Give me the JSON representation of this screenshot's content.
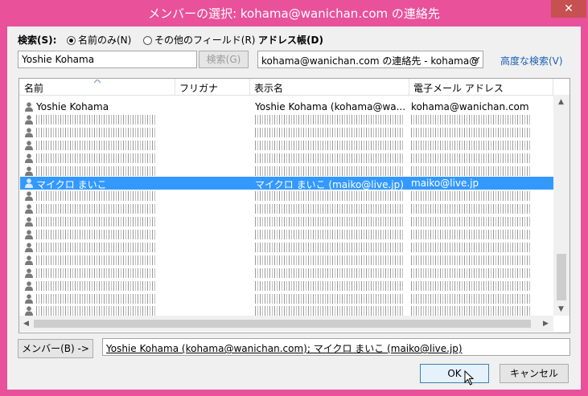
{
  "window": {
    "title": "メンバーの選択: kohama@wanichan.com の連絡先",
    "close_label": "✕"
  },
  "search": {
    "label": "検索(S):",
    "option_name_only": "名前のみ(N)",
    "option_other_fields": "その他のフィールド(R)",
    "selected_option": "名前のみ(N)",
    "query": "Yoshie Kohama",
    "search_button": "検索(G)"
  },
  "address_book": {
    "label": "アドレス帳(D)",
    "selected": "kohama@wanichan.com の連絡先 - kohama@",
    "advanced_search": "高度な検索(V)"
  },
  "table": {
    "columns": [
      "名前",
      "フリガナ",
      "表示名",
      "電子メール アドレス"
    ],
    "rows": [
      {
        "name": "Yoshie Kohama",
        "furigana": "",
        "display": "Yoshie Kohama (kohama@wa...",
        "email": "kohama@wanichan.com",
        "selected": false,
        "obscured": false
      },
      {
        "name": "",
        "furigana": "",
        "display": "",
        "email": "",
        "selected": false,
        "obscured": true
      },
      {
        "name": "",
        "furigana": "",
        "display": "",
        "email": "",
        "selected": false,
        "obscured": true
      },
      {
        "name": "",
        "furigana": "",
        "display": "",
        "email": "",
        "selected": false,
        "obscured": true
      },
      {
        "name": "",
        "furigana": "",
        "display": "",
        "email": "",
        "selected": false,
        "obscured": true
      },
      {
        "name": "",
        "furigana": "",
        "display": "",
        "email": "",
        "selected": false,
        "obscured": true
      },
      {
        "name": "マイクロ まいこ",
        "furigana": "",
        "display": "マイクロ まいこ (maiko@live.jp)",
        "email": "maiko@live.jp",
        "selected": true,
        "obscured": false
      },
      {
        "name": "",
        "furigana": "",
        "display": "",
        "email": "",
        "selected": false,
        "obscured": true
      },
      {
        "name": "",
        "furigana": "",
        "display": "",
        "email": "",
        "selected": false,
        "obscured": true
      },
      {
        "name": "",
        "furigana": "",
        "display": "",
        "email": "",
        "selected": false,
        "obscured": true
      },
      {
        "name": "",
        "furigana": "",
        "display": "",
        "email": "",
        "selected": false,
        "obscured": true
      },
      {
        "name": "",
        "furigana": "",
        "display": "",
        "email": "",
        "selected": false,
        "obscured": true
      },
      {
        "name": "",
        "furigana": "",
        "display": "",
        "email": "",
        "selected": false,
        "obscured": true
      },
      {
        "name": "",
        "furigana": "",
        "display": "",
        "email": "",
        "selected": false,
        "obscured": true
      },
      {
        "name": "",
        "furigana": "",
        "display": "",
        "email": "",
        "selected": false,
        "obscured": true
      },
      {
        "name": "",
        "furigana": "",
        "display": "",
        "email": "",
        "selected": false,
        "obscured": true
      },
      {
        "name": "",
        "furigana": "",
        "display": "",
        "email": "",
        "selected": false,
        "obscured": true
      }
    ]
  },
  "members": {
    "button": "メンバー(B) ->",
    "value": "Yoshie Kohama (kohama@wanichan.com); マイクロ まいこ (maiko@live.jp)"
  },
  "footer": {
    "ok": "OK",
    "cancel": "キャンセル"
  },
  "colors": {
    "window_frame": "#e9519b",
    "selection": "#3399ff",
    "link": "#1a5fb4"
  }
}
